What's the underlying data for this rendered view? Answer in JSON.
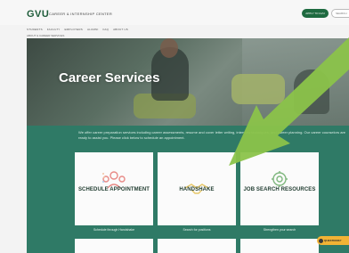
{
  "header": {
    "logo": "GVU",
    "center_name": "CAREER & INTERNSHIP CENTER",
    "apply_button": "APPLY TO GVU",
    "search_button": "SEARCH"
  },
  "nav": {
    "items": [
      "STUDENTS",
      "FACULTY",
      "EMPLOYERS",
      "ALUMNI",
      "FAQ",
      "ABOUT US"
    ]
  },
  "breadcrumb": "ABOUT & CAREER SERVICES",
  "hero": {
    "title": "Career Services"
  },
  "intro": {
    "text": "We offer career preparation services including career assessments, resume and cover letter writing, interview techniques, and career planning. Our career counselors are ready to assist you. Please click below to schedule an appointment."
  },
  "cards": [
    {
      "title": "SCHEDULE APPOINTMENT",
      "caption": "Schedule through Handshake",
      "icon": "people-network-icon",
      "icon_color": "#e88a86"
    },
    {
      "title": "HANDSHAKE",
      "caption": "Search for positions",
      "icon": "handshake-icon",
      "icon_color": "#e7c869"
    },
    {
      "title": "JOB SEARCH RESOURCES",
      "caption": "Strengthen your search",
      "icon": "gear-search-icon",
      "icon_color": "#7fb77e"
    }
  ],
  "chat": {
    "label": "QUESTIONS?"
  },
  "colors": {
    "brand_green": "#1e6a40",
    "section_green": "#2f7a66",
    "arrow": "#8bc34a",
    "chat_badge": "#f2b335"
  }
}
